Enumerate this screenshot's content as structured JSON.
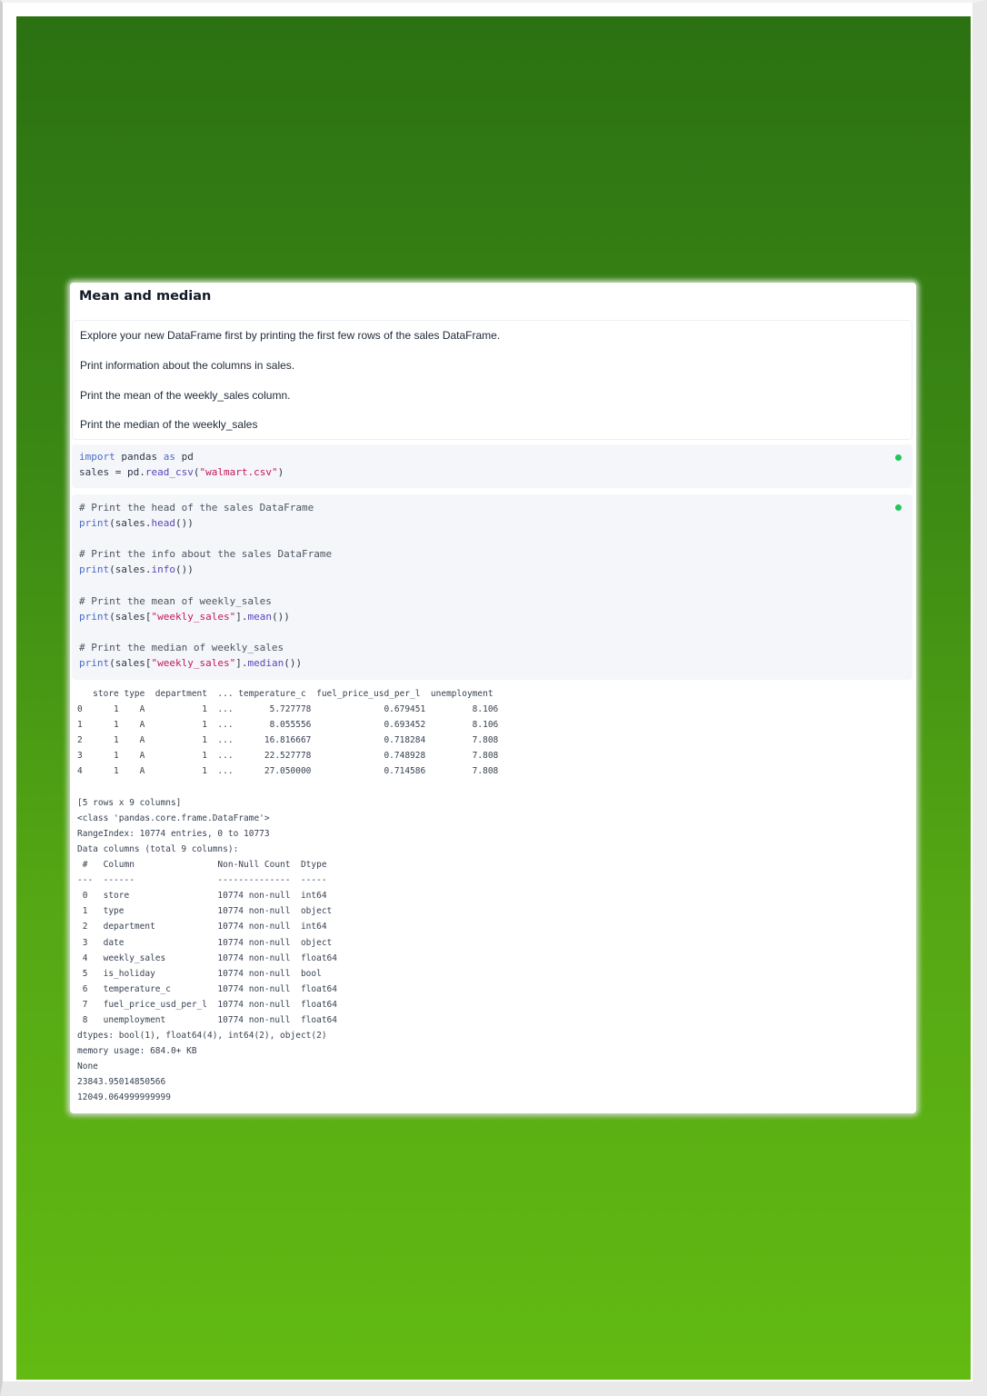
{
  "card": {
    "title": "Mean and median"
  },
  "instructions": [
    "Explore your new DataFrame first by printing the first few rows of the sales DataFrame.",
    "Print information about the columns in sales.",
    "Print the mean of the weekly_sales column.",
    "Print the median of the weekly_sales"
  ],
  "cell1": {
    "status_color": "#22c55e",
    "lines": [
      {
        "kw": "import",
        "mid": " pandas ",
        "kw2": "as",
        "rest": " pd"
      },
      {
        "pre": "sales = pd.",
        "fn": "read_csv",
        "open": "(",
        "str": "\"walmart.csv\"",
        "close": ")"
      }
    ]
  },
  "cell2": {
    "status_color": "#22c55e",
    "comments": [
      "# Print the head of the sales DataFrame",
      "# Print the info about the sales DataFrame",
      "# Print the mean of weekly_sales",
      "# Print the median of weekly_sales"
    ],
    "calls": [
      {
        "print": "print",
        "a": "(sales.",
        "fn": "head",
        "b": "())"
      },
      {
        "print": "print",
        "a": "(sales.",
        "fn": "info",
        "b": "())"
      },
      {
        "print": "print",
        "a": "(sales[",
        "str": "\"weekly_sales\"",
        "b": "].",
        "fn": "mean",
        "c": "())"
      },
      {
        "print": "print",
        "a": "(sales[",
        "str": "\"weekly_sales\"",
        "b": "].",
        "fn": "median",
        "c": "())"
      }
    ]
  },
  "output": [
    "   store type  department  ... temperature_c  fuel_price_usd_per_l  unemployment",
    "0      1    A           1  ...       5.727778              0.679451         8.106",
    "1      1    A           1  ...       8.055556              0.693452         8.106",
    "2      1    A           1  ...      16.816667              0.718284         7.808",
    "3      1    A           1  ...      22.527778              0.748928         7.808",
    "4      1    A           1  ...      27.050000              0.714586         7.808",
    "",
    "[5 rows x 9 columns]",
    "<class 'pandas.core.frame.DataFrame'>",
    "RangeIndex: 10774 entries, 0 to 10773",
    "Data columns (total 9 columns):",
    " #   Column                Non-Null Count  Dtype  ",
    "---  ------                --------------  -----  ",
    " 0   store                 10774 non-null  int64  ",
    " 1   type                  10774 non-null  object ",
    " 2   department            10774 non-null  int64  ",
    " 3   date                  10774 non-null  object ",
    " 4   weekly_sales          10774 non-null  float64",
    " 5   is_holiday            10774 non-null  bool   ",
    " 6   temperature_c         10774 non-null  float64",
    " 7   fuel_price_usd_per_l  10774 non-null  float64",
    " 8   unemployment          10774 non-null  float64",
    "dtypes: bool(1), float64(4), int64(2), object(2)",
    "memory usage: 684.0+ KB",
    "None",
    "23843.95014850566",
    "12049.064999999999"
  ]
}
